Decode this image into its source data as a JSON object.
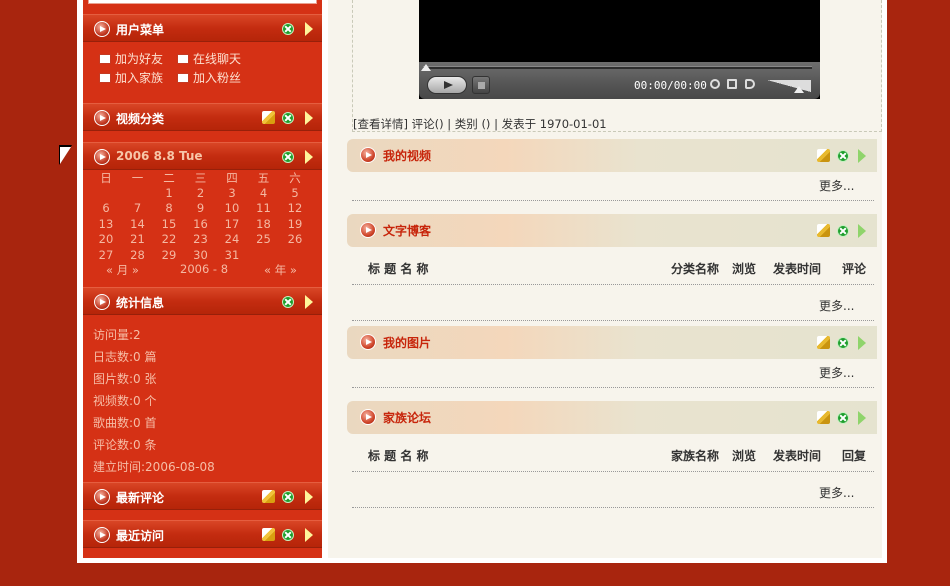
{
  "sidebar": {
    "user_menu": {
      "title": "用户菜单",
      "items": [
        {
          "label": "加为好友",
          "icon": "add-friend-icon"
        },
        {
          "label": "在线聊天",
          "icon": "mail-icon"
        },
        {
          "label": "加入家族",
          "icon": "add-family-icon"
        },
        {
          "label": "加入粉丝",
          "icon": "fan-card-icon"
        }
      ]
    },
    "video_cat": {
      "title": "视频分类"
    },
    "calendar": {
      "title": "2006 8.8 Tue",
      "weekdays": [
        "日",
        "一",
        "二",
        "三",
        "四",
        "五",
        "六"
      ],
      "rows": [
        [
          "",
          "",
          "1",
          "2",
          "3",
          "4",
          "5"
        ],
        [
          "6",
          "7",
          "8",
          "9",
          "10",
          "11",
          "12"
        ],
        [
          "13",
          "14",
          "15",
          "16",
          "17",
          "18",
          "19"
        ],
        [
          "20",
          "21",
          "22",
          "23",
          "24",
          "25",
          "26"
        ],
        [
          "27",
          "28",
          "29",
          "30",
          "31",
          "",
          ""
        ]
      ],
      "nav_month": "« 月 »",
      "current": "2006 - 8",
      "nav_year": "« 年 »"
    },
    "stats": {
      "title": "统计信息",
      "lines": [
        "访问量:2",
        "日志数:0 篇",
        "图片数:0 张",
        "视频数:0 个",
        "歌曲数:0 首",
        "评论数:0 条",
        "建立时间:2006-08-08"
      ]
    },
    "latest_comments": {
      "title": "最新评论"
    },
    "recent_visits": {
      "title": "最近访问"
    }
  },
  "player": {
    "time": "00:00/00:00",
    "meta": "[查看详情] 评论() | 类别  () | 发表于  1970-01-01"
  },
  "sections": [
    {
      "title": "我的视频",
      "more": "更多..."
    },
    {
      "title": "文字博客",
      "more": "更多...",
      "columns": [
        "标 题 名 称",
        "分类名称",
        "浏览",
        "发表时间",
        "评论"
      ]
    },
    {
      "title": "我的图片",
      "more": "更多..."
    },
    {
      "title": "家族论坛",
      "more": "更多...",
      "columns": [
        "标 题 名 称",
        "家族名称",
        "浏览",
        "发表时间",
        "回复"
      ]
    }
  ],
  "colors": {
    "background": "#a8250e",
    "sidebar": "#d53115",
    "main": "#f7f4ec",
    "section_title": "#c7250b"
  }
}
